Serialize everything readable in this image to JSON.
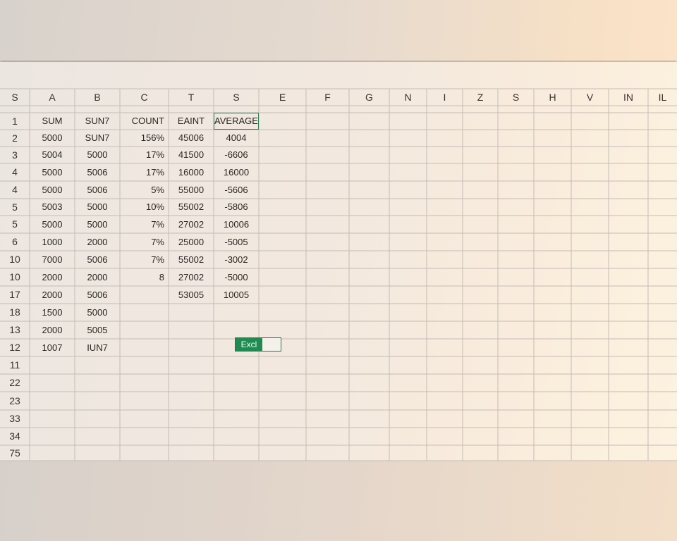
{
  "corner_label": "S",
  "columns": [
    "A",
    "B",
    "C",
    "T",
    "S",
    "E",
    "F",
    "G",
    "N",
    "I",
    "Z",
    "S",
    "H",
    "V",
    "IN",
    "IL"
  ],
  "rows": [
    {
      "num": "1",
      "cells": [
        "SUM",
        "SUN7",
        "COUNT",
        "EAINT",
        "AVERAGE"
      ]
    },
    {
      "num": "2",
      "cells": [
        "5000",
        "SUN7",
        "156%",
        "45006",
        "4004"
      ]
    },
    {
      "num": "3",
      "cells": [
        "5004",
        "5000",
        "17%",
        "41500",
        "-6606"
      ]
    },
    {
      "num": "4",
      "cells": [
        "5000",
        "5006",
        "17%",
        "16000",
        "16000"
      ]
    },
    {
      "num": "4",
      "cells": [
        "5000",
        "5006",
        "5%",
        "55000",
        "-5606"
      ]
    },
    {
      "num": "5",
      "cells": [
        "5003",
        "5000",
        "10%",
        "55002",
        "-5806"
      ]
    },
    {
      "num": "5",
      "cells": [
        "5000",
        "5000",
        "7%",
        "27002",
        "10006"
      ]
    },
    {
      "num": "6",
      "cells": [
        "1000",
        "2000",
        "7%",
        "25000",
        "-5005"
      ]
    },
    {
      "num": "10",
      "cells": [
        "7000",
        "5006",
        "7%",
        "55002",
        "-3002"
      ]
    },
    {
      "num": "10",
      "cells": [
        "2000",
        "2000",
        "8",
        "27002",
        "-5000"
      ]
    },
    {
      "num": "17",
      "cells": [
        "2000",
        "5006",
        "",
        "53005",
        "10005"
      ]
    },
    {
      "num": "18",
      "cells": [
        "1500",
        "5000",
        "",
        "",
        ""
      ]
    },
    {
      "num": "13",
      "cells": [
        "2000",
        "5005",
        "",
        "",
        ""
      ]
    },
    {
      "num": "12",
      "cells": [
        "1007",
        "IUN7",
        "",
        "",
        ""
      ]
    },
    {
      "num": "11",
      "cells": [
        "",
        "",
        "",
        "",
        ""
      ]
    },
    {
      "num": "22",
      "cells": [
        "",
        "",
        "",
        "",
        ""
      ]
    },
    {
      "num": "23",
      "cells": [
        "",
        "",
        "",
        "",
        ""
      ]
    },
    {
      "num": "33",
      "cells": [
        "",
        "",
        "",
        "",
        ""
      ]
    },
    {
      "num": "34",
      "cells": [
        "",
        "",
        "",
        "",
        ""
      ]
    },
    {
      "num": "75",
      "cells": [
        "",
        "",
        "",
        "",
        ""
      ]
    }
  ],
  "excel_tag": {
    "label": "Excl"
  },
  "colors": {
    "grid": "#c4bcb4",
    "accent": "#1f8a52"
  }
}
